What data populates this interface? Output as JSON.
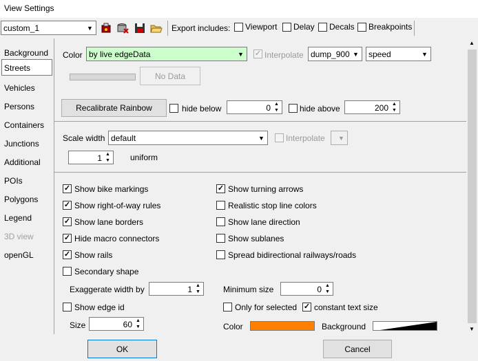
{
  "window": {
    "title": "View Settings"
  },
  "toolbar": {
    "scheme": "custom_1",
    "export_label": "Export includes:",
    "export_options": [
      {
        "label": "Viewport",
        "checked": false
      },
      {
        "label": "Delay",
        "checked": false
      },
      {
        "label": "Decals",
        "checked": false
      },
      {
        "label": "Breakpoints",
        "checked": false
      }
    ]
  },
  "tabs": [
    {
      "label": "Background"
    },
    {
      "label": "Streets",
      "active": true
    },
    {
      "label": "Vehicles"
    },
    {
      "label": "Persons"
    },
    {
      "label": "Containers"
    },
    {
      "label": "Junctions"
    },
    {
      "label": "Additional"
    },
    {
      "label": "POIs"
    },
    {
      "label": "Polygons"
    },
    {
      "label": "Legend"
    },
    {
      "label": "3D view",
      "disabled": true
    },
    {
      "label": "openGL"
    }
  ],
  "color_section": {
    "label": "Color",
    "scheme": "by live edgeData",
    "scheme_bg": "#ccffcc",
    "interpolate_label": "Interpolate",
    "interpolate_checked": true,
    "data_source": "dump_900",
    "attribute": "speed",
    "no_data_label": "No Data",
    "recalibrate_label": "Recalibrate Rainbow",
    "hide_below_label": "hide below",
    "hide_below_value": "0",
    "hide_above_label": "hide above",
    "hide_above_value": "200"
  },
  "scale_section": {
    "label": "Scale width",
    "scheme": "default",
    "interpolate_label": "Interpolate",
    "value": "1",
    "value_label": "uniform"
  },
  "options_left": [
    {
      "label": "Show bike markings",
      "checked": true
    },
    {
      "label": "Show right-of-way rules",
      "checked": true
    },
    {
      "label": "Show lane borders",
      "checked": true
    },
    {
      "label": "Hide macro connectors",
      "checked": true
    },
    {
      "label": "Show rails",
      "checked": true
    },
    {
      "label": "Secondary shape",
      "checked": false
    }
  ],
  "options_right": [
    {
      "label": "Show turning arrows",
      "checked": true
    },
    {
      "label": "Realistic stop line colors",
      "checked": false
    },
    {
      "label": "Show lane direction",
      "checked": false
    },
    {
      "label": "Show sublanes",
      "checked": false
    },
    {
      "label": "Spread bidirectional railways/roads",
      "checked": false
    }
  ],
  "exaggerate": {
    "label": "Exaggerate width by",
    "value": "1"
  },
  "minimum_size": {
    "label": "Minimum size",
    "value": "0"
  },
  "edge_id": {
    "label": "Show edge id",
    "checked": false,
    "only_selected_label": "Only for selected",
    "only_selected_checked": false,
    "constant_text_label": "constant text size",
    "constant_text_checked": true,
    "size_label": "Size",
    "size_value": "60",
    "color_label": "Color",
    "color_value": "#ff8000",
    "background_label": "Background"
  },
  "buttons": {
    "ok": "OK",
    "cancel": "Cancel"
  }
}
